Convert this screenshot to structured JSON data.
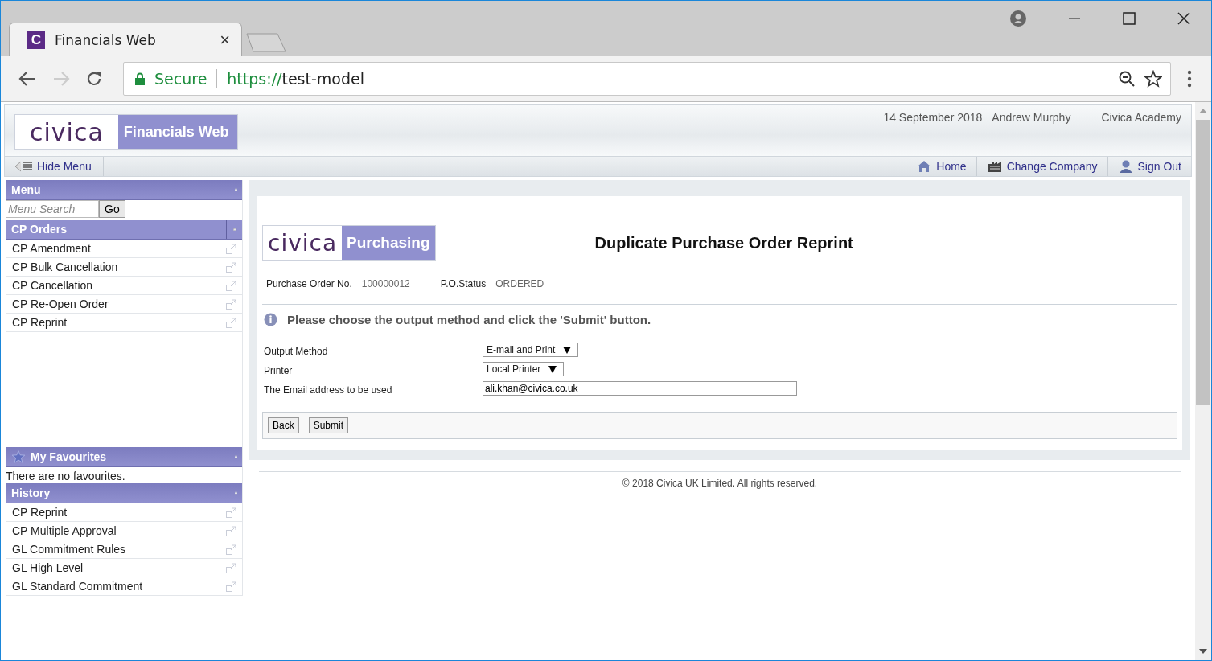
{
  "browser": {
    "tab_title": "Financials Web",
    "tab_icon_letter": "C",
    "close": "×",
    "secure_label": "Secure",
    "url_scheme": "https://",
    "url_host": "test-model"
  },
  "header": {
    "logo_text": "civica",
    "product": "Financials Web",
    "date": "14 September 2018",
    "user": "Andrew Murphy",
    "company": "Civica Academy"
  },
  "navbar": {
    "hide_menu": "Hide Menu",
    "links": [
      {
        "kind": "home",
        "label": "Home"
      },
      {
        "kind": "company",
        "label": "Change Company"
      },
      {
        "kind": "signout",
        "label": "Sign Out"
      }
    ]
  },
  "sidebar": {
    "menu_title": "Menu",
    "search_placeholder": "Menu Search",
    "go": "Go",
    "sections": [
      {
        "title": "CP Orders",
        "items": [
          "CP Amendment",
          "CP Bulk Cancellation",
          "CP Cancellation",
          "CP Re-Open Order",
          "CP Reprint"
        ]
      }
    ],
    "favourites_title": "My Favourites",
    "favourites_empty": "There are no favourites.",
    "history_title": "History",
    "history": [
      "CP Reprint",
      "CP Multiple Approval",
      "GL Commitment Rules",
      "GL High Level",
      "GL Standard Commitment"
    ]
  },
  "form": {
    "logo_text": "civica",
    "module": "Purchasing",
    "title": "Duplicate Purchase Order Reprint",
    "info": [
      {
        "label": "Purchase Order No.",
        "value": "100000012"
      },
      {
        "label": "P.O.Status",
        "value": "ORDERED"
      }
    ],
    "instruction": "Please choose the output method and click the 'Submit' button.",
    "fields": [
      {
        "kind": "select",
        "label": "Output Method",
        "value": "E-mail and Print"
      },
      {
        "kind": "select",
        "label": "Printer",
        "value": "Local Printer"
      },
      {
        "kind": "text",
        "label": "The Email address to be used",
        "value": "ali.khan@civica.co.uk"
      }
    ],
    "buttons": [
      "Back",
      "Submit"
    ]
  },
  "footer": "© 2018 Civica UK Limited. All rights reserved."
}
